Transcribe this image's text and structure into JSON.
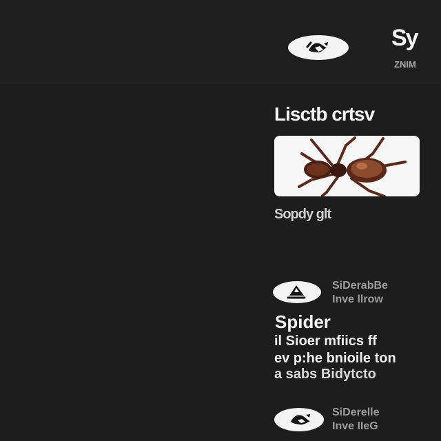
{
  "header": {
    "title": "Sy",
    "subtitle": "ZNIM",
    "avatar_icon": "user-avatar-icon"
  },
  "section": {
    "title": "Lisctb crtsv"
  },
  "media": {
    "image_icon": "spider-image-icon",
    "caption": "Sopdy glt"
  },
  "post": {
    "avatar_icon": "user-avatar-icon",
    "meta_line_1": "SiDerabBe",
    "meta_line_2": "Inve llrow",
    "heading": "Spider",
    "body_lines": [
      "il Sioer mfiics ff",
      "ev p:he bnioile ton",
      "a sabs Bidytcto"
    ]
  },
  "post_2": {
    "avatar_icon": "user-avatar-icon",
    "meta_line_1": "SiDerelle",
    "meta_line_2": "Inve IIeG"
  },
  "colors": {
    "background": "#1d1d1e",
    "text": "#f5f5f5",
    "muted": "#9c9c9c",
    "card": "#f6f6f6"
  }
}
